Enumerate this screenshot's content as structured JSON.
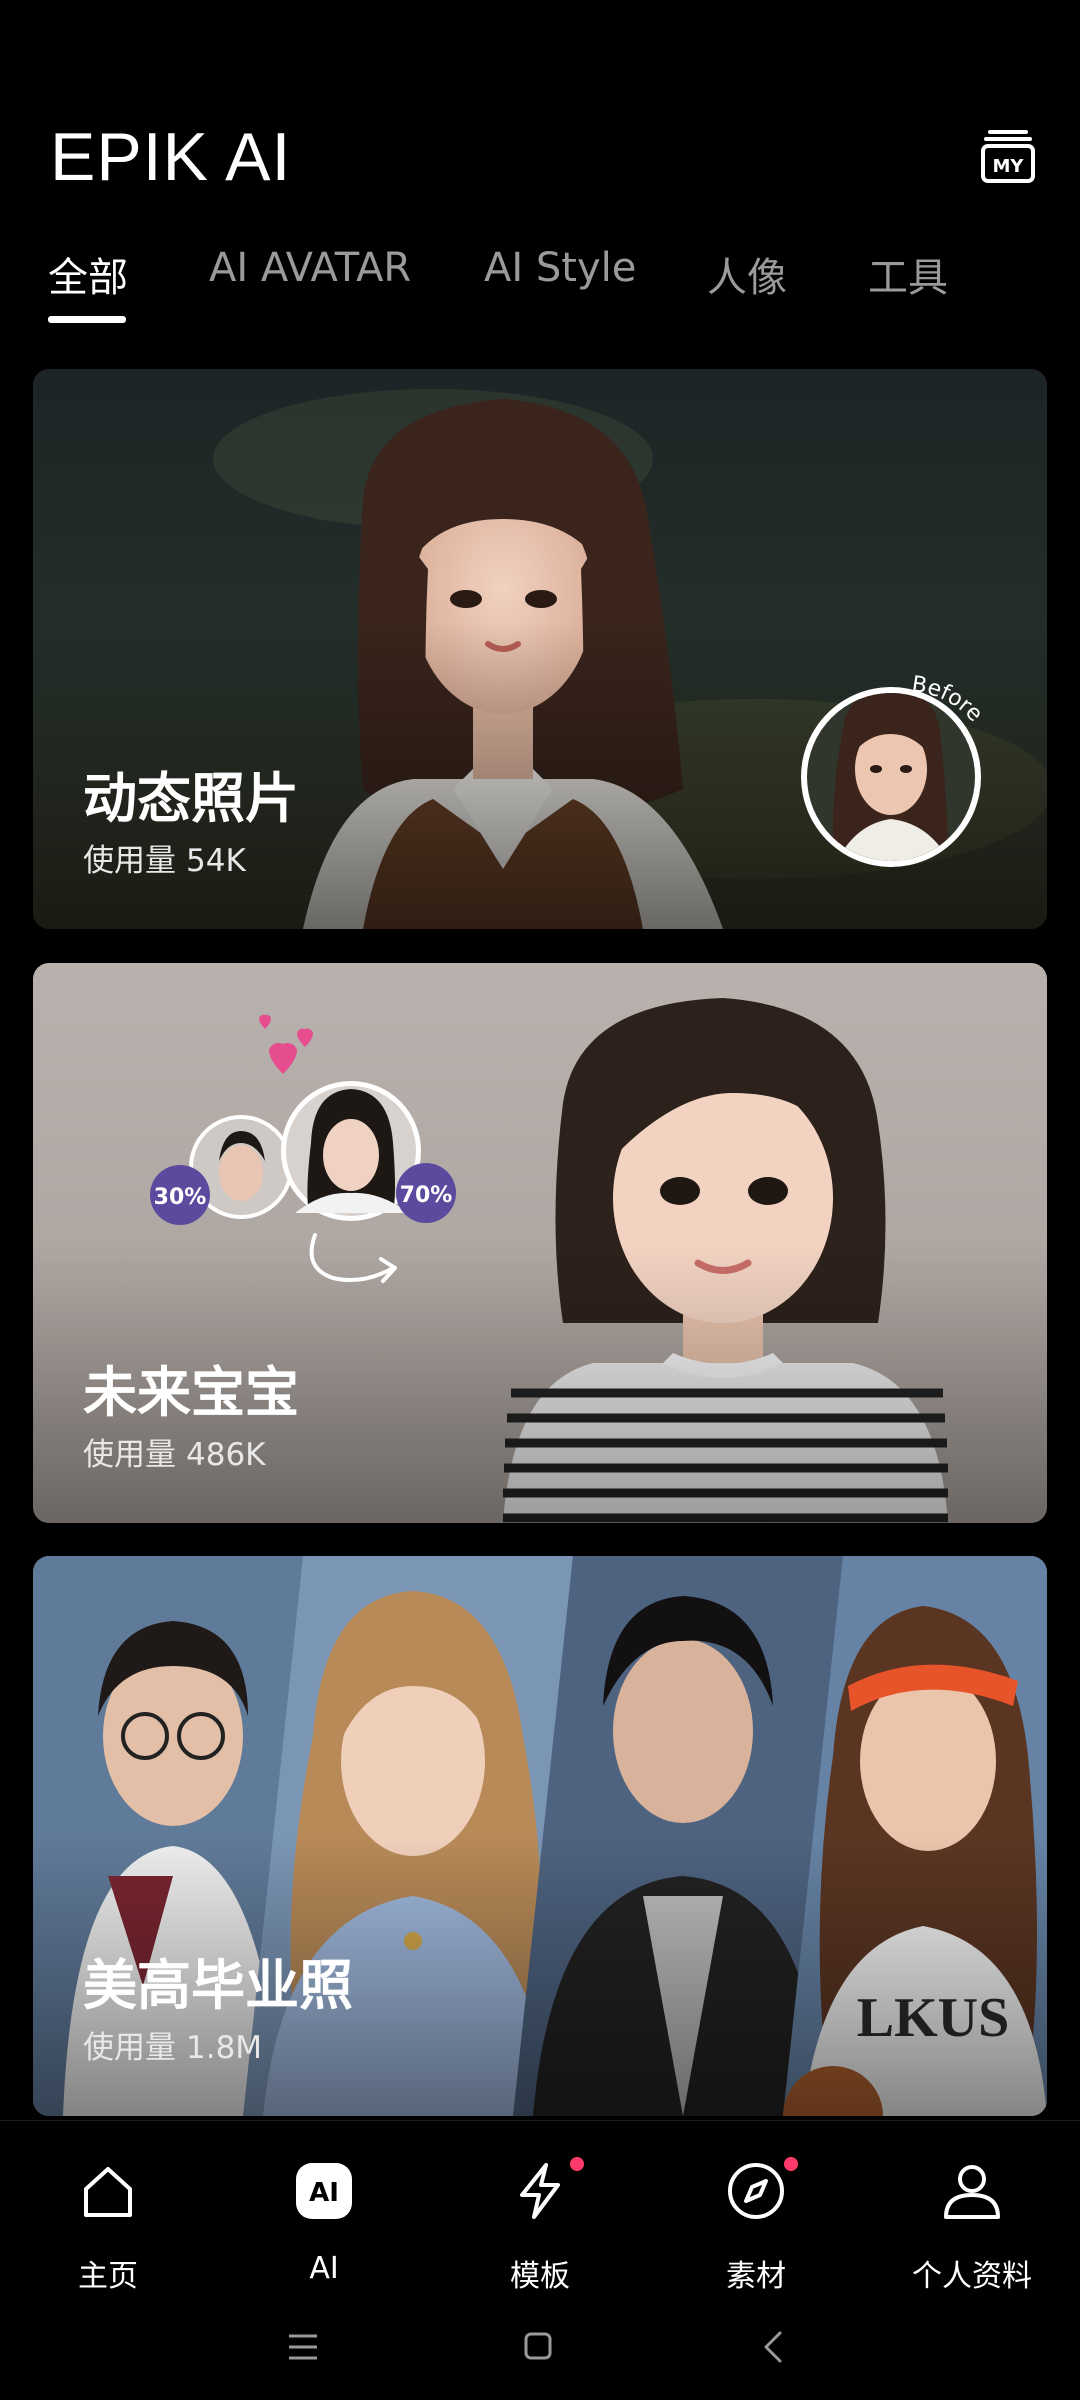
{
  "header": {
    "title": "EPIK AI",
    "my_badge": "MY"
  },
  "tabs": [
    {
      "label": "全部",
      "active": true
    },
    {
      "label": "AI AVATAR",
      "active": false
    },
    {
      "label": "AI Style",
      "active": false
    },
    {
      "label": "人像",
      "active": false
    },
    {
      "label": "工具",
      "active": false
    }
  ],
  "cards": [
    {
      "title": "动态照片",
      "usage_prefix": "使用量",
      "usage_value": "54K",
      "before_label": "Before"
    },
    {
      "title": "未来宝宝",
      "usage_prefix": "使用量",
      "usage_value": "486K",
      "left_percent": "30%",
      "right_percent": "70%"
    },
    {
      "title": "美高毕业照",
      "usage_prefix": "使用量",
      "usage_value": "1.8M",
      "jersey_text": "LKUS"
    }
  ],
  "nav": [
    {
      "label": "主页",
      "icon": "home-icon"
    },
    {
      "label": "AI",
      "icon": "ai-icon",
      "badge": "AI"
    },
    {
      "label": "模板",
      "icon": "lightning-icon"
    },
    {
      "label": "素材",
      "icon": "compass-icon"
    },
    {
      "label": "个人资料",
      "icon": "person-icon"
    }
  ],
  "colors": {
    "background": "#000000",
    "active_tab": "#ffffff",
    "inactive_tab": "#9a9a9a",
    "notification_dot": "#ff3b6b",
    "percent_badge": "#5b4a9e"
  }
}
